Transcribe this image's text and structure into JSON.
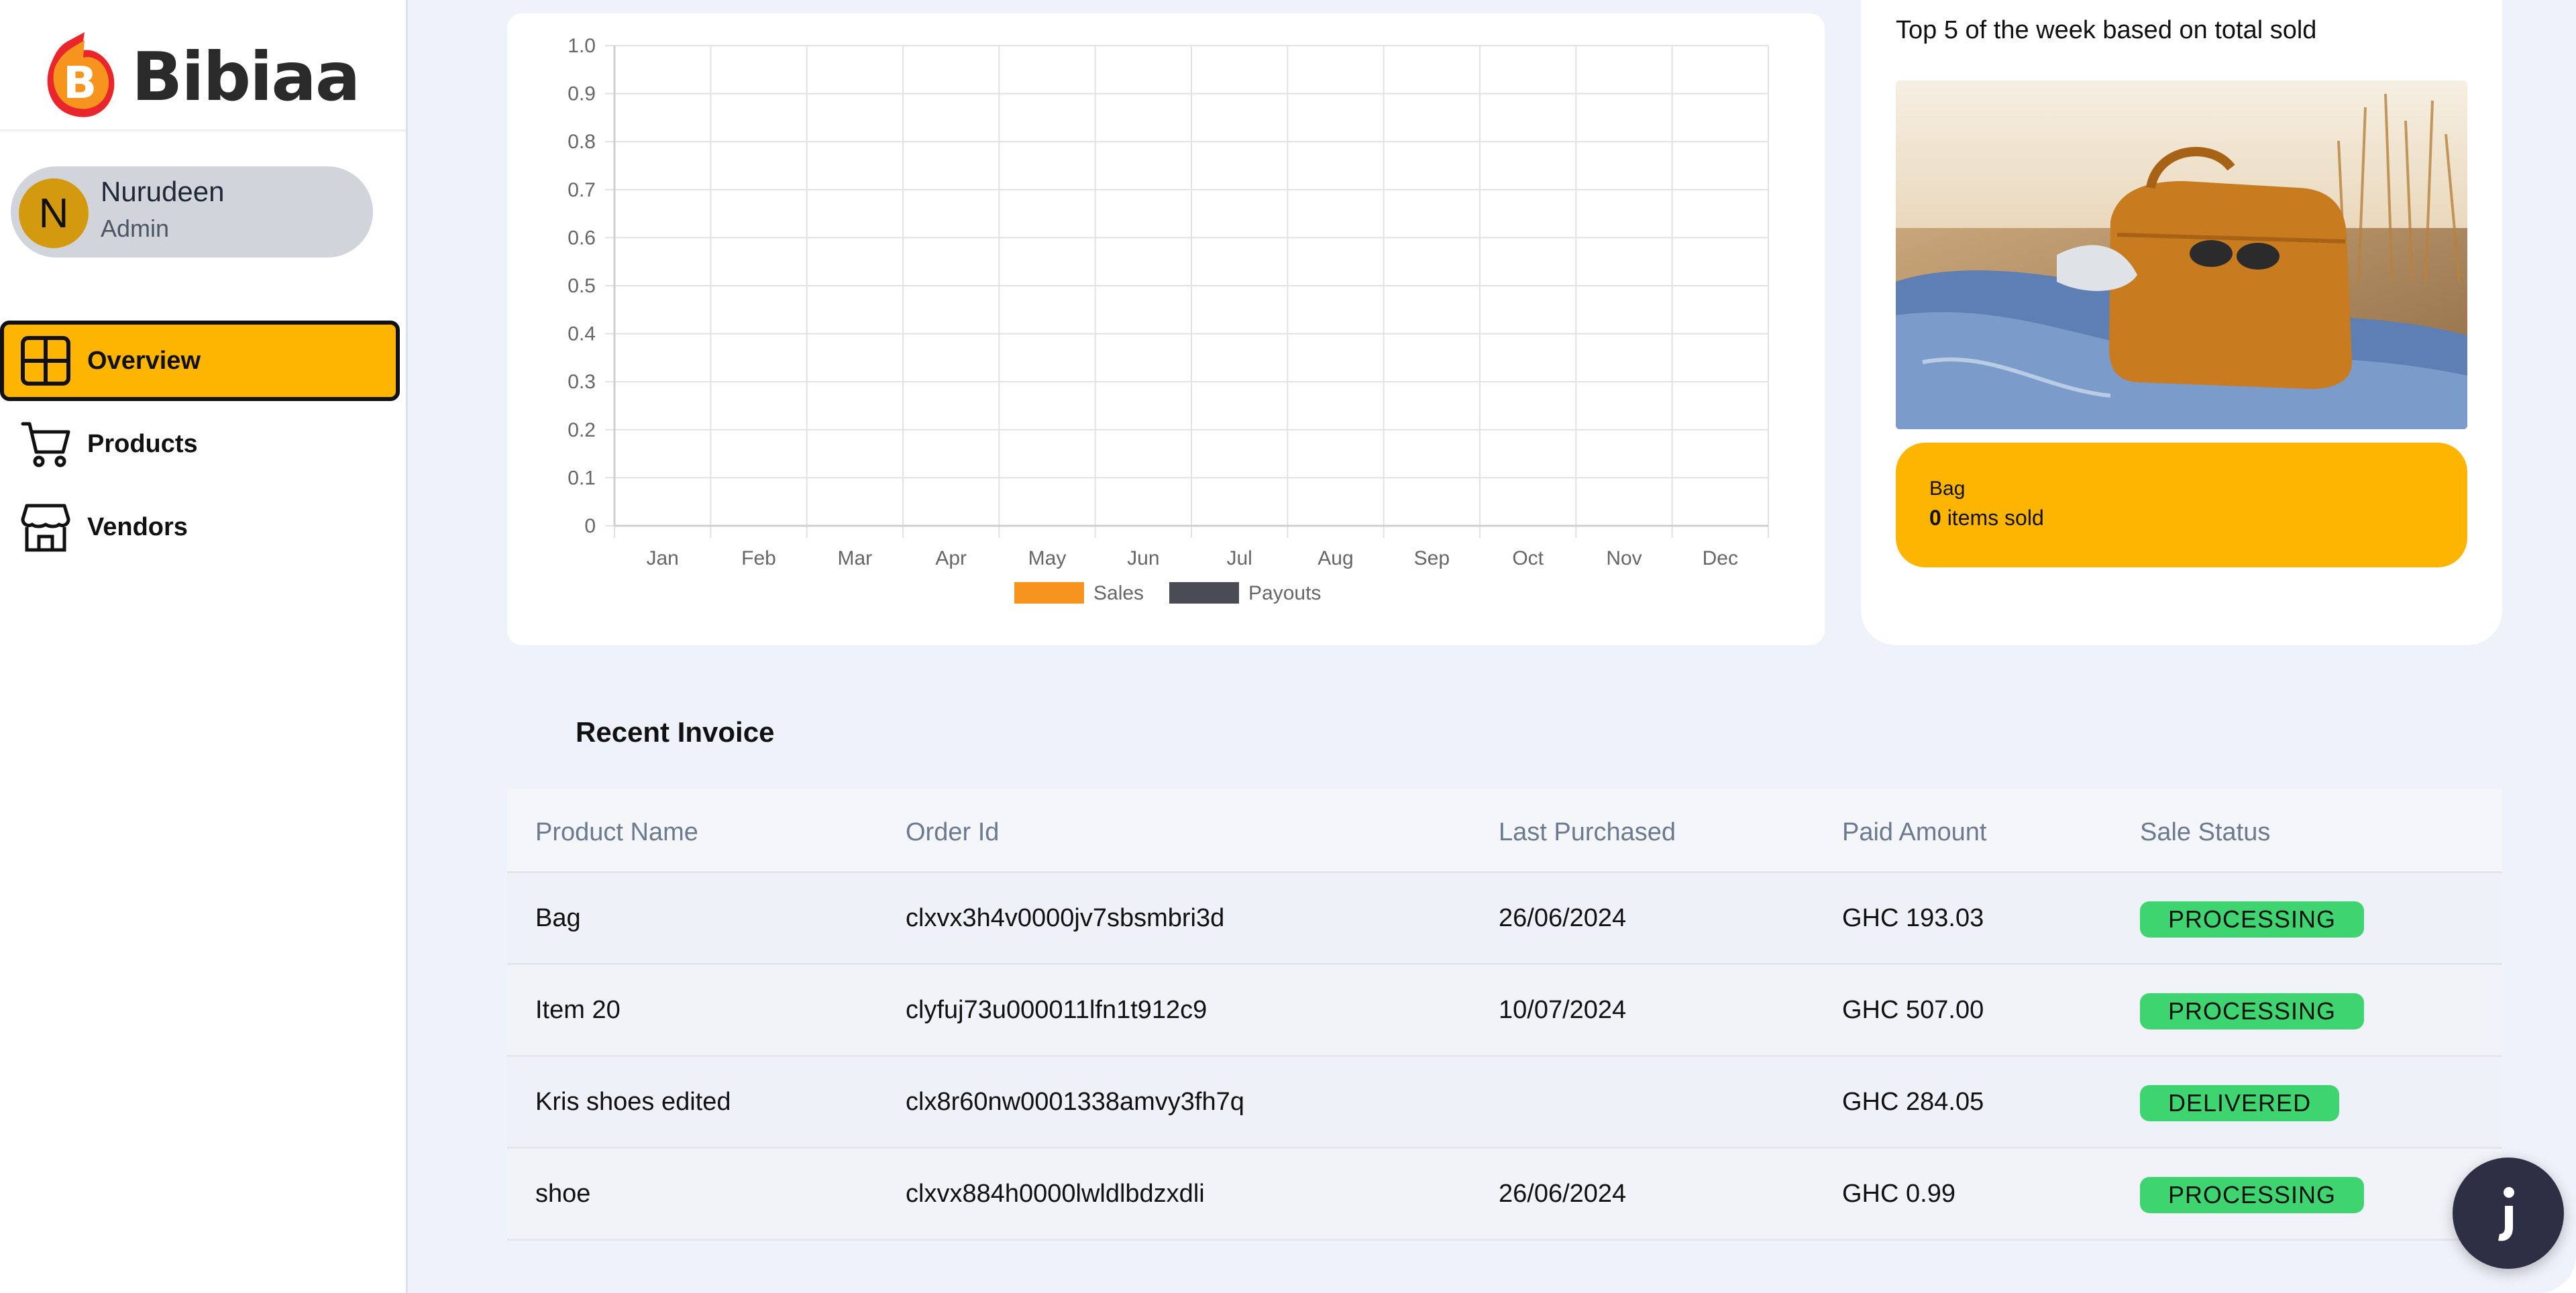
{
  "brand": {
    "name": "Bibiaa",
    "logo_letter": "B"
  },
  "user": {
    "initial": "N",
    "name": "Nurudeen",
    "role": "Admin"
  },
  "nav": [
    {
      "label": "Overview",
      "icon": "grid-icon",
      "active": true
    },
    {
      "label": "Products",
      "icon": "cart-icon",
      "active": false
    },
    {
      "label": "Vendors",
      "icon": "store-icon",
      "active": false
    }
  ],
  "chart_data": {
    "type": "bar",
    "categories": [
      "Jan",
      "Feb",
      "Mar",
      "Apr",
      "May",
      "Jun",
      "Jul",
      "Aug",
      "Sep",
      "Oct",
      "Nov",
      "Dec"
    ],
    "series": [
      {
        "name": "Sales",
        "color": "#f7941d",
        "values": [
          0,
          0,
          0,
          0,
          0,
          0,
          0,
          0,
          0,
          0,
          0,
          0
        ]
      },
      {
        "name": "Payouts",
        "color": "#4b4b55",
        "values": [
          0,
          0,
          0,
          0,
          0,
          0,
          0,
          0,
          0,
          0,
          0,
          0
        ]
      }
    ],
    "yticks": [
      "0",
      "0.1",
      "0.2",
      "0.3",
      "0.4",
      "0.5",
      "0.6",
      "0.7",
      "0.8",
      "0.9",
      "1.0"
    ],
    "ylim": [
      0,
      1
    ],
    "grid": true,
    "legend": "bottom"
  },
  "top_products": {
    "title": "Top 5 of the week based on total sold",
    "product_name": "Bag",
    "sold_count": "0",
    "sold_suffix": " items sold"
  },
  "invoice": {
    "title": "Recent Invoice",
    "headers": [
      "Product Name",
      "Order Id",
      "Last Purchased",
      "Paid Amount",
      "Sale Status"
    ],
    "rows": [
      {
        "product": "Bag",
        "order_id": "clxvx3h4v0000jv7sbsmbri3d",
        "date": "26/06/2024",
        "amount": "GHC 193.03",
        "status": "PROCESSING"
      },
      {
        "product": "Item 20",
        "order_id": "clyfuj73u000011lfn1t912c9",
        "date": "10/07/2024",
        "amount": "GHC 507.00",
        "status": "PROCESSING"
      },
      {
        "product": "Kris shoes edited",
        "order_id": "clx8r60nw0001338amvy3fh7q",
        "date": "",
        "amount": "GHC 284.05",
        "status": "DELIVERED"
      },
      {
        "product": "shoe",
        "order_id": "clxvx884h0000lwldlbdzxdli",
        "date": "26/06/2024",
        "amount": "GHC 0.99",
        "status": "PROCESSING"
      }
    ]
  },
  "colors": {
    "accent": "#fdb501",
    "status_green": "#3ed571"
  }
}
